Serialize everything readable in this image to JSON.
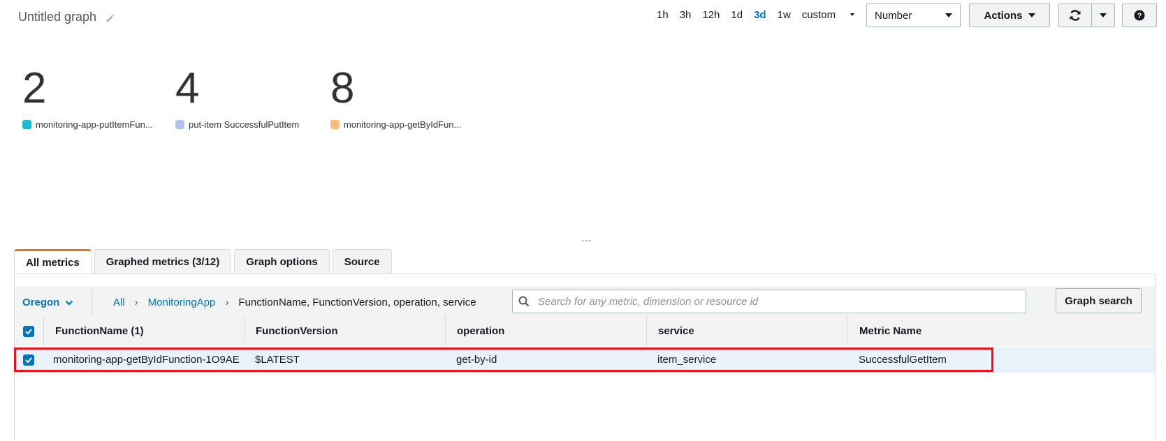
{
  "header": {
    "title": "Untitled graph",
    "time_ranges": [
      "1h",
      "3h",
      "12h",
      "1d",
      "3d",
      "1w"
    ],
    "active_range": "3d",
    "custom_label": "custom",
    "view_select": "Number",
    "actions_label": "Actions",
    "icons": {
      "edit": "pencil-icon",
      "refresh": "refresh-icon",
      "help": "help-icon"
    }
  },
  "stats": [
    {
      "value": "2",
      "legend": "monitoring-app-putItemFun...",
      "color": "#1fb8d1"
    },
    {
      "value": "4",
      "legend": "put-item SuccessfulPutItem",
      "color": "#aec7e8"
    },
    {
      "value": "8",
      "legend": "monitoring-app-getByIdFun...",
      "color": "#ffbb78"
    }
  ],
  "resize_handle": "---",
  "tabs": [
    {
      "label": "All metrics",
      "active": true
    },
    {
      "label": "Graphed metrics (3/12)",
      "active": false
    },
    {
      "label": "Graph options",
      "active": false
    },
    {
      "label": "Source",
      "active": false
    }
  ],
  "browser": {
    "region": "Oregon",
    "breadcrumb": {
      "all": "All",
      "namespace": "MonitoringApp",
      "dimensions": "FunctionName, FunctionVersion, operation, service"
    },
    "search_placeholder": "Search for any metric, dimension or resource id",
    "graph_search_label": "Graph search"
  },
  "table": {
    "columns": [
      "FunctionName (1)",
      "FunctionVersion",
      "operation",
      "service",
      "Metric Name"
    ],
    "rows": [
      {
        "checked": true,
        "cells": [
          "monitoring-app-getByIdFunction-1O9AE",
          "$LATEST",
          "get-by-id",
          "item_service",
          "SuccessfulGetItem"
        ]
      }
    ]
  },
  "highlight_color": "#e8121b"
}
